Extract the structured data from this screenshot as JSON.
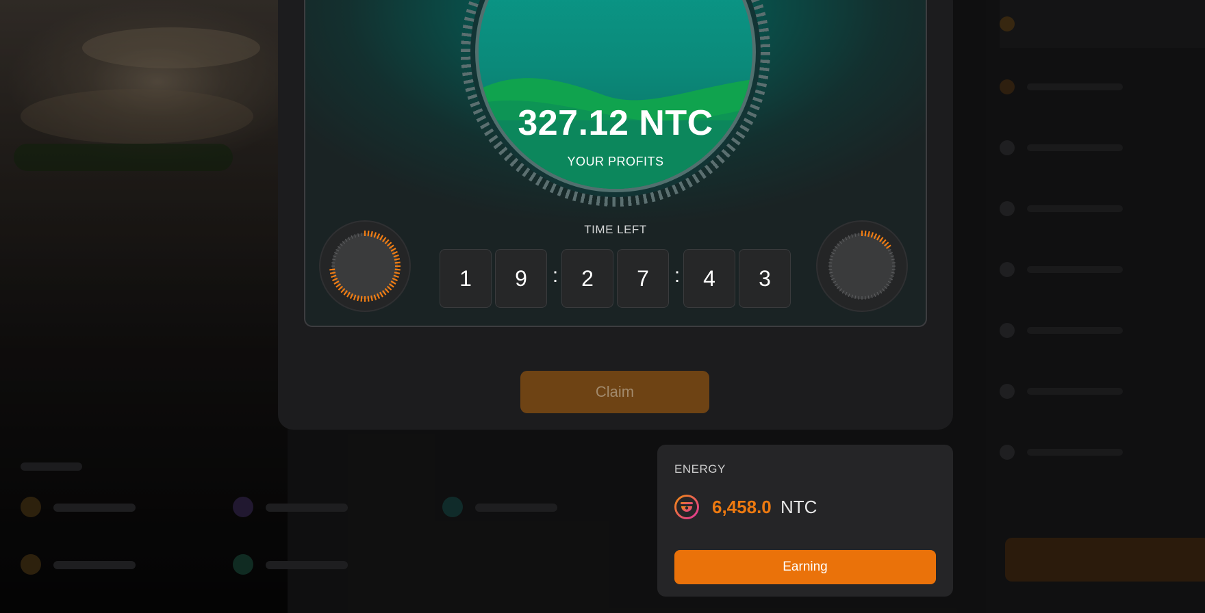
{
  "profit": {
    "value": "327.12 NTC",
    "label": "YOUR PROFITS"
  },
  "timer": {
    "label": "TIME LEFT",
    "digits": [
      "1",
      "9",
      "2",
      "7",
      "4",
      "3"
    ],
    "separator": ":"
  },
  "claim": {
    "label": "Claim"
  },
  "energy": {
    "label": "ENERGY",
    "value": "6,458.0",
    "unit": "NTC",
    "button_label": "Earning",
    "icon": "token-icon"
  },
  "colors": {
    "accent": "#ea720a",
    "claim_disabled": "#6e4314",
    "orb_teal": "#0aa090",
    "orb_green": "#10a34e"
  }
}
